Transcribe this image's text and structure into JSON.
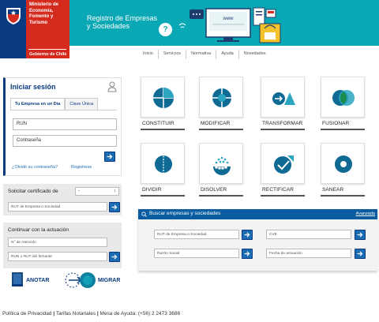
{
  "header": {
    "ministry": "Ministerio de Economía, Fomento y Turismo",
    "government": "Gobierno de Chile",
    "site_title_line1": "Registro de Empresas",
    "site_title_line2": "y Sociedades",
    "help": "?",
    "illustration_text": "www"
  },
  "nav": [
    "Inicio",
    "Servicios",
    "Normativa",
    "Ayuda",
    "Novedades"
  ],
  "login": {
    "title": "Iniciar sesión",
    "tab_active": "Tu Empresa en un Día",
    "tab_other": "Clave Única",
    "run_value": "RUN",
    "password_value": "Contraseña",
    "forgot": "¿Olvidó su contraseña?",
    "register": "Registrese"
  },
  "certificate": {
    "title": "Solicitar certificado de",
    "select_value": "-",
    "field_placeholder": "RUT de Empresa o Sociedad"
  },
  "continue": {
    "title": "Continuar con la actuación",
    "field1": "N° de Atención",
    "field2": "RUN o RUT del firmante"
  },
  "actions": {
    "anotar": "ANOTAR",
    "migrar": "MIGRAR"
  },
  "tiles": [
    {
      "label": "CONSTITUIR",
      "icon": "constituir-icon"
    },
    {
      "label": "MODIFICAR",
      "icon": "modificar-icon"
    },
    {
      "label": "TRANSFORMAR",
      "icon": "transformar-icon"
    },
    {
      "label": "FUSIONAR",
      "icon": "fusionar-icon"
    },
    {
      "label": "DIVIDIR",
      "icon": "dividir-icon"
    },
    {
      "label": "DISOLVER",
      "icon": "disolver-icon"
    },
    {
      "label": "RECTIFICAR",
      "icon": "rectificar-icon"
    },
    {
      "label": "SANEAR",
      "icon": "sanear-icon"
    }
  ],
  "search": {
    "title": "Buscar empresas y sociedades",
    "advanced": "Avanzada",
    "rut_placeholder": "RUT de Empresa o Sociedad",
    "cve_placeholder": "CVE",
    "razon_placeholder": "Razón Social",
    "fecha_placeholder": "Fecha de actuación"
  },
  "footer": {
    "privacy": "Política de Privacidad",
    "fees": "Tarifas Notariales",
    "helpdesk": "Mesa de Ayuda: (+56) 2 2473 3686",
    "sep": "|"
  },
  "colors": {
    "teal": "#0aa8b4",
    "navy": "#0a3b80",
    "red": "#d52b1e",
    "blue_button": "#1c6cb3"
  }
}
